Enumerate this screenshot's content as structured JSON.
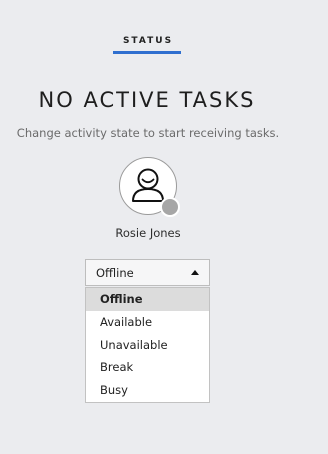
{
  "tabs": [
    {
      "label": "STATUS",
      "active": true
    }
  ],
  "empty_state": {
    "title": "NO ACTIVE TASKS",
    "message": "Change activity state to start receiving tasks."
  },
  "user": {
    "name": "Rosie Jones",
    "avatar_icon": "person-icon",
    "presence_color": "#a6a6a6"
  },
  "activity_select": {
    "value": "Offline",
    "caret_icon": "caret-up-icon",
    "options": [
      {
        "label": "Offline",
        "selected": true
      },
      {
        "label": "Available",
        "selected": false
      },
      {
        "label": "Unavailable",
        "selected": false
      },
      {
        "label": "Break",
        "selected": false
      },
      {
        "label": "Busy",
        "selected": false
      }
    ]
  },
  "colors": {
    "accent": "#2f6fcf",
    "background": "#ebecef"
  }
}
